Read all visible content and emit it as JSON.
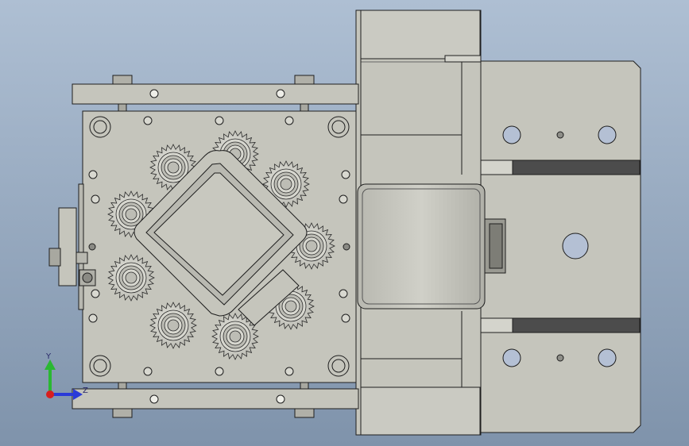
{
  "viewport": {
    "background_top": "#aebfd3",
    "background_bottom": "#7f93ab",
    "part_color": "#c5c5bc",
    "edge_color": "#1e1e1e",
    "shadow_color": "#8d8d86"
  },
  "triad": {
    "y_label": "Y",
    "z_label": "Z",
    "y_color": "#2ab832",
    "z_color": "#2a3ad8",
    "x_color": "#d81e1e"
  }
}
